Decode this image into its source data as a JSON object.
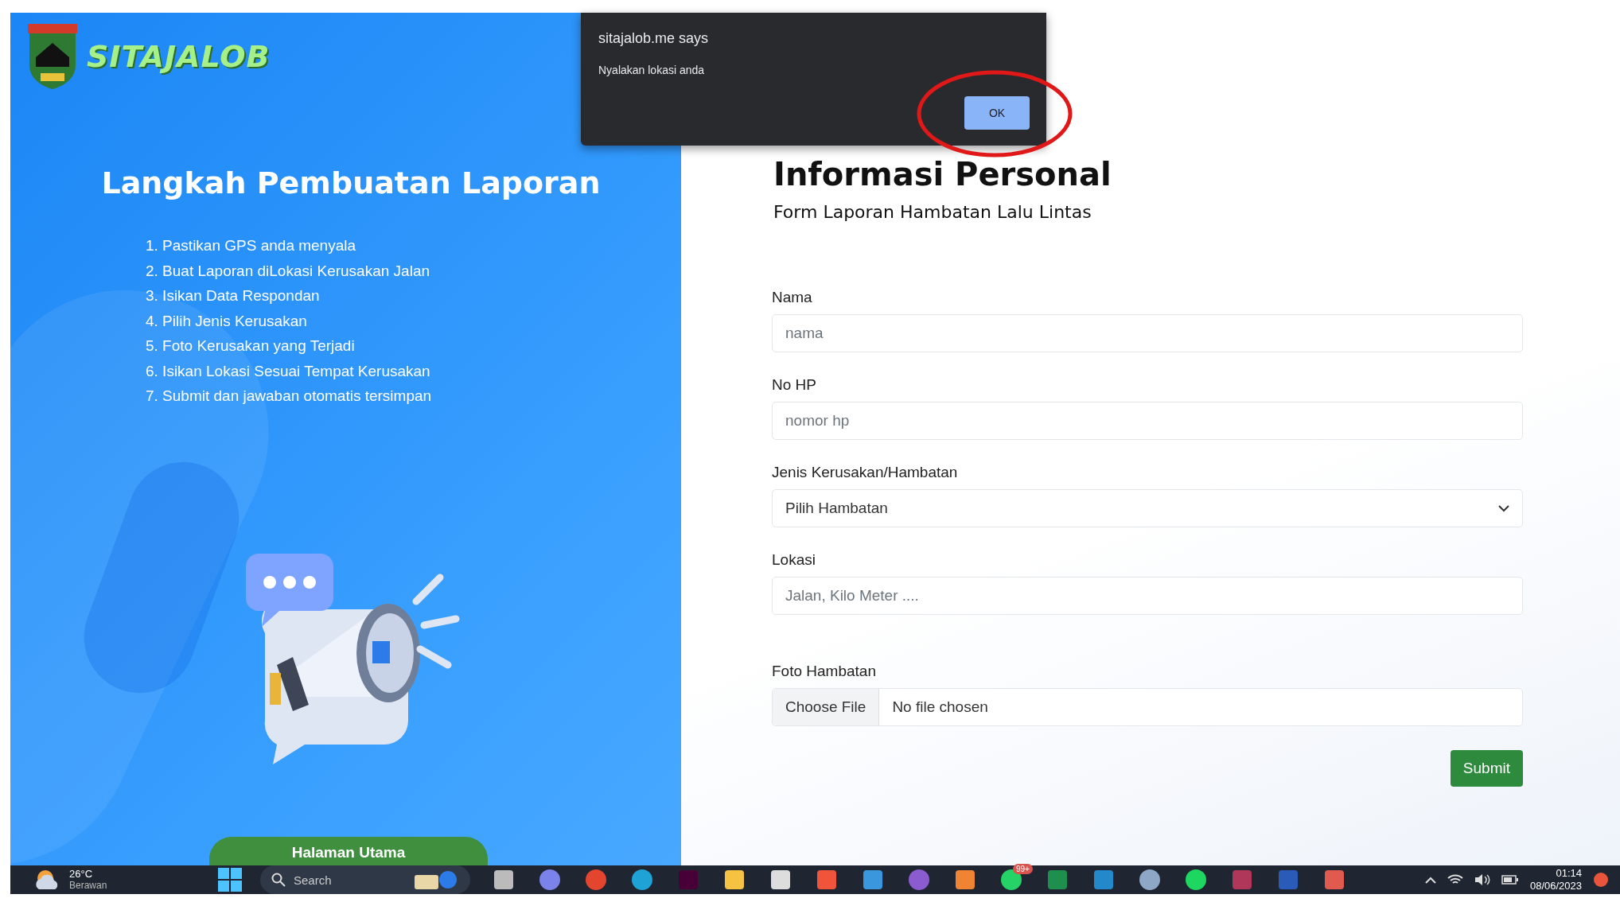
{
  "brand": {
    "name": "SITAJALOB"
  },
  "steps_panel": {
    "title": "Langkah Pembuatan Laporan",
    "steps": [
      "1. Pastikan GPS anda menyala",
      "2. Buat Laporan diLokasi Kerusakan Jalan",
      "3. Isikan Data Respondan",
      "4. Pilih Jenis Kerusakan",
      "5. Foto Kerusakan yang Terjadi",
      "6. Isikan Lokasi Sesuai Tempat Kerusakan",
      "7. Submit dan jawaban otomatis tersimpan"
    ],
    "home_button": "Halaman Utama"
  },
  "form": {
    "title": "Informasi Personal",
    "subtitle": "Form Laporan Hambatan Lalu Lintas",
    "fields": [
      {
        "kind": "text",
        "label": "Nama",
        "placeholder": "nama"
      },
      {
        "kind": "text",
        "label": "No HP",
        "placeholder": "nomor hp"
      },
      {
        "kind": "select",
        "label": "Jenis Kerusakan/Hambatan",
        "value": "Pilih Hambatan"
      },
      {
        "kind": "text",
        "label": "Lokasi",
        "placeholder": "Jalan, Kilo Meter ...."
      },
      {
        "kind": "file",
        "label": "Foto Hambatan",
        "button": "Choose File",
        "value": "No file chosen"
      }
    ],
    "submit": "Submit"
  },
  "dialog": {
    "origin": "sitajalob.me says",
    "message": "Nyalakan lokasi anda",
    "ok_button": "OK"
  },
  "taskbar": {
    "weather": {
      "temperature": "26°C",
      "condition": "Berawan"
    },
    "search": "Search",
    "badge": "99+",
    "time": "01:14",
    "date": "08/06/2023"
  }
}
